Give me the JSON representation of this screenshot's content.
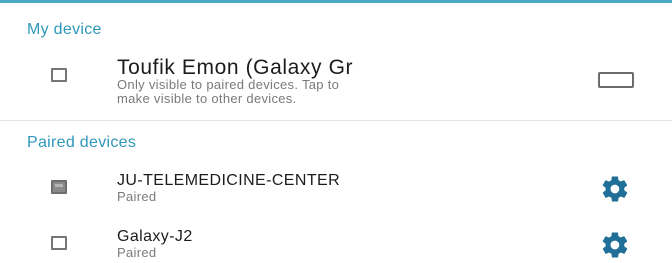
{
  "sections": {
    "my_device_header": "My device",
    "paired_devices_header": "Paired devices"
  },
  "my_device": {
    "name": "Toufik Emon (Galaxy Gr",
    "description_line1": "Only visible to paired devices. Tap to",
    "description_line2": "make visible to other devices.",
    "visibility_toggle_icon": "device-frame-icon"
  },
  "paired_devices": [
    {
      "name": "JU-TELEMEDICINE-CENTER",
      "status": "Paired",
      "device_icon": "computer-icon",
      "settings_icon": "gear-icon"
    },
    {
      "name": "Galaxy-J2",
      "status": "Paired",
      "device_icon": "phone-icon",
      "settings_icon": "gear-icon"
    }
  ],
  "colors": {
    "accent": "#2f97b9",
    "gear": "#1f6f98",
    "title_text": "#1c1c1c",
    "secondary_text": "#7a7a7a"
  }
}
